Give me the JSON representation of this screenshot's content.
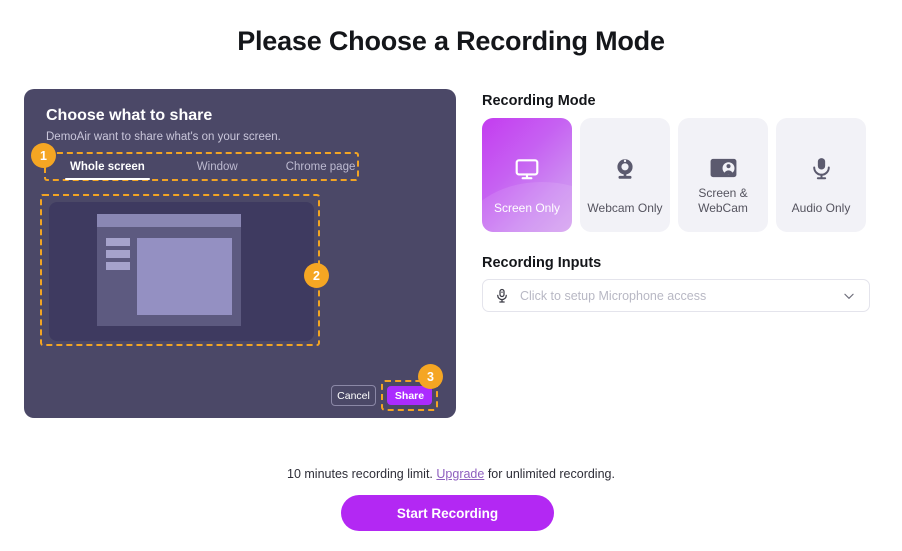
{
  "page": {
    "title": "Please Choose a Recording Mode"
  },
  "share_dialog": {
    "title": "Choose what to share",
    "subtitle": "DemoAir want to share what's on your screen.",
    "tabs": [
      {
        "label": "Whole screen",
        "active": true
      },
      {
        "label": "Window",
        "active": false
      },
      {
        "label": "Chrome page",
        "active": false
      }
    ],
    "cancel_label": "Cancel",
    "share_label": "Share",
    "preview_icon": "browser-window-mockup-icon"
  },
  "badges": [
    {
      "number": "1",
      "target": "whole-screen-tab"
    },
    {
      "number": "2",
      "target": "screen-preview"
    },
    {
      "number": "3",
      "target": "share-button"
    }
  ],
  "recording_mode": {
    "label": "Recording Mode",
    "options": [
      {
        "label": "Screen Only",
        "icon": "monitor-icon",
        "selected": true
      },
      {
        "label": "Webcam Only",
        "icon": "webcam-icon",
        "selected": false
      },
      {
        "label": "Screen & WebCam",
        "icon": "screen-webcam-icon",
        "selected": false
      },
      {
        "label": "Audio Only",
        "icon": "microphone-icon",
        "selected": false
      }
    ]
  },
  "recording_inputs": {
    "label": "Recording Inputs",
    "microphone": {
      "icon": "microphone-icon",
      "placeholder": "Click to setup Microphone access",
      "value": "",
      "chevron": "chevron-down-icon"
    }
  },
  "footer": {
    "note_prefix": "10 minutes recording limit. ",
    "upgrade_label": "Upgrade",
    "note_suffix": " for unlimited recording.",
    "start_label": "Start Recording"
  },
  "colors": {
    "accent_purple": "#b328f3",
    "badge_orange": "#f5a623",
    "dialog_bg": "#4b4867",
    "dashed_highlight": "#f2a423",
    "upgrade_link": "#8e5fbf"
  }
}
